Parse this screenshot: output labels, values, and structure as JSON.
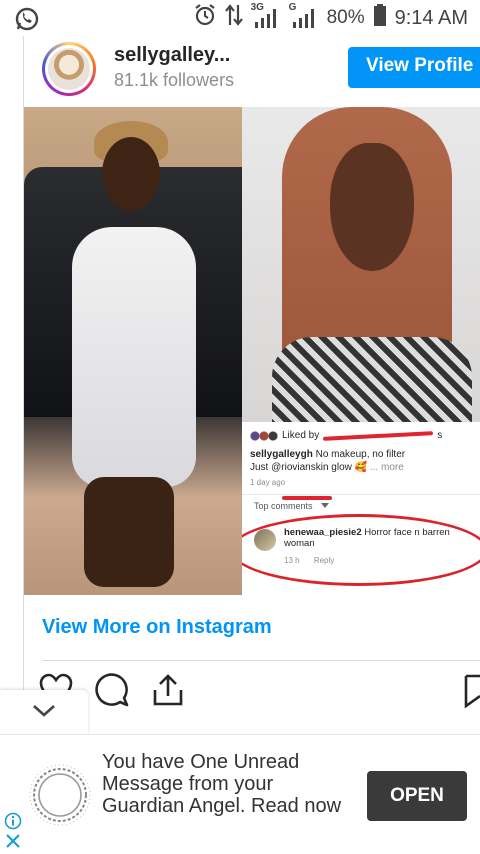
{
  "status_bar": {
    "network_3g": "3G",
    "network_g": "G",
    "battery": "80%",
    "time": "9:14 AM",
    "icons": [
      "whatsapp-icon",
      "alarm-icon",
      "data-transfer-icon",
      "signal-icon",
      "battery-icon"
    ]
  },
  "header": {
    "username": "sellygalley...",
    "followers": "81.1k followers",
    "view_profile": "View Profile"
  },
  "post_screenshot": {
    "liked_by": "Liked by",
    "liked_tail": "s",
    "caption_user": "sellygalleygh",
    "caption_text": "No makeup, no filter",
    "caption_line2": "Just @riovianskin glow 🥰",
    "more": "... more",
    "time": "1 day ago",
    "top_comments": "Top comments",
    "comment_user": "henewaa_piesie2",
    "comment_text": "Horror face n barren woman",
    "comment_time": "13 h",
    "reply": "Reply"
  },
  "view_more": "View More on Instagram",
  "actions": [
    "heart-icon",
    "comment-icon",
    "share-icon",
    "bookmark-icon"
  ],
  "ad": {
    "text": "You have One Unread Message from your Guardian Angel. Read now",
    "button": "OPEN",
    "info_icon": "info-icon",
    "close_icon": "close-icon"
  },
  "colors": {
    "accent_blue": "#0095f6",
    "red_annotation": "#d9242b",
    "ad_button": "#3a3a3a"
  }
}
